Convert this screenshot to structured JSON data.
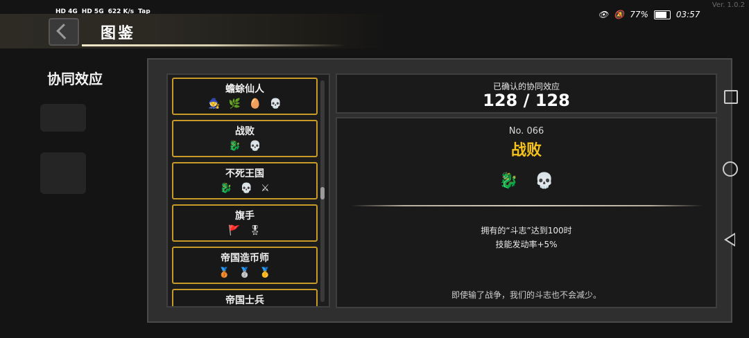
{
  "status_bar": {
    "network_1": "HD 4G",
    "network_2": "HD 5G",
    "speed": "622 K/s",
    "app": "Tap",
    "battery": "77%",
    "time": "03:57"
  },
  "version": "Ver. 1.0.2",
  "header": {
    "title": "图鉴"
  },
  "sidebar": {
    "heading": "协同效应"
  },
  "synergy_list": [
    {
      "name": "蟾蜍仙人",
      "icons": [
        "🧙",
        "🌿",
        "🥚",
        "💀"
      ]
    },
    {
      "name": "战败",
      "icons": [
        "🐉",
        "💀"
      ]
    },
    {
      "name": "不死王国",
      "icons": [
        "🐉",
        "💀",
        "⚔"
      ]
    },
    {
      "name": "旗手",
      "icons": [
        "🚩",
        "🎖"
      ]
    },
    {
      "name": "帝国造币师",
      "icons": [
        "🥉",
        "🥈",
        "🥇"
      ]
    },
    {
      "name": "帝国士兵",
      "icons": []
    }
  ],
  "counter": {
    "label": "已确认的协同效应",
    "value": "128 / 128"
  },
  "detail": {
    "number": "No. 066",
    "title": "战败",
    "icons": [
      "🐉",
      "💀"
    ],
    "desc_line1": "拥有的“斗志”达到100时",
    "desc_line2": "技能发动率+5%",
    "flavor": "即使输了战争，我们的斗志也不会减少。"
  },
  "colors": {
    "accent_gold": "#f6c21c",
    "item_border": "#c89a28"
  }
}
